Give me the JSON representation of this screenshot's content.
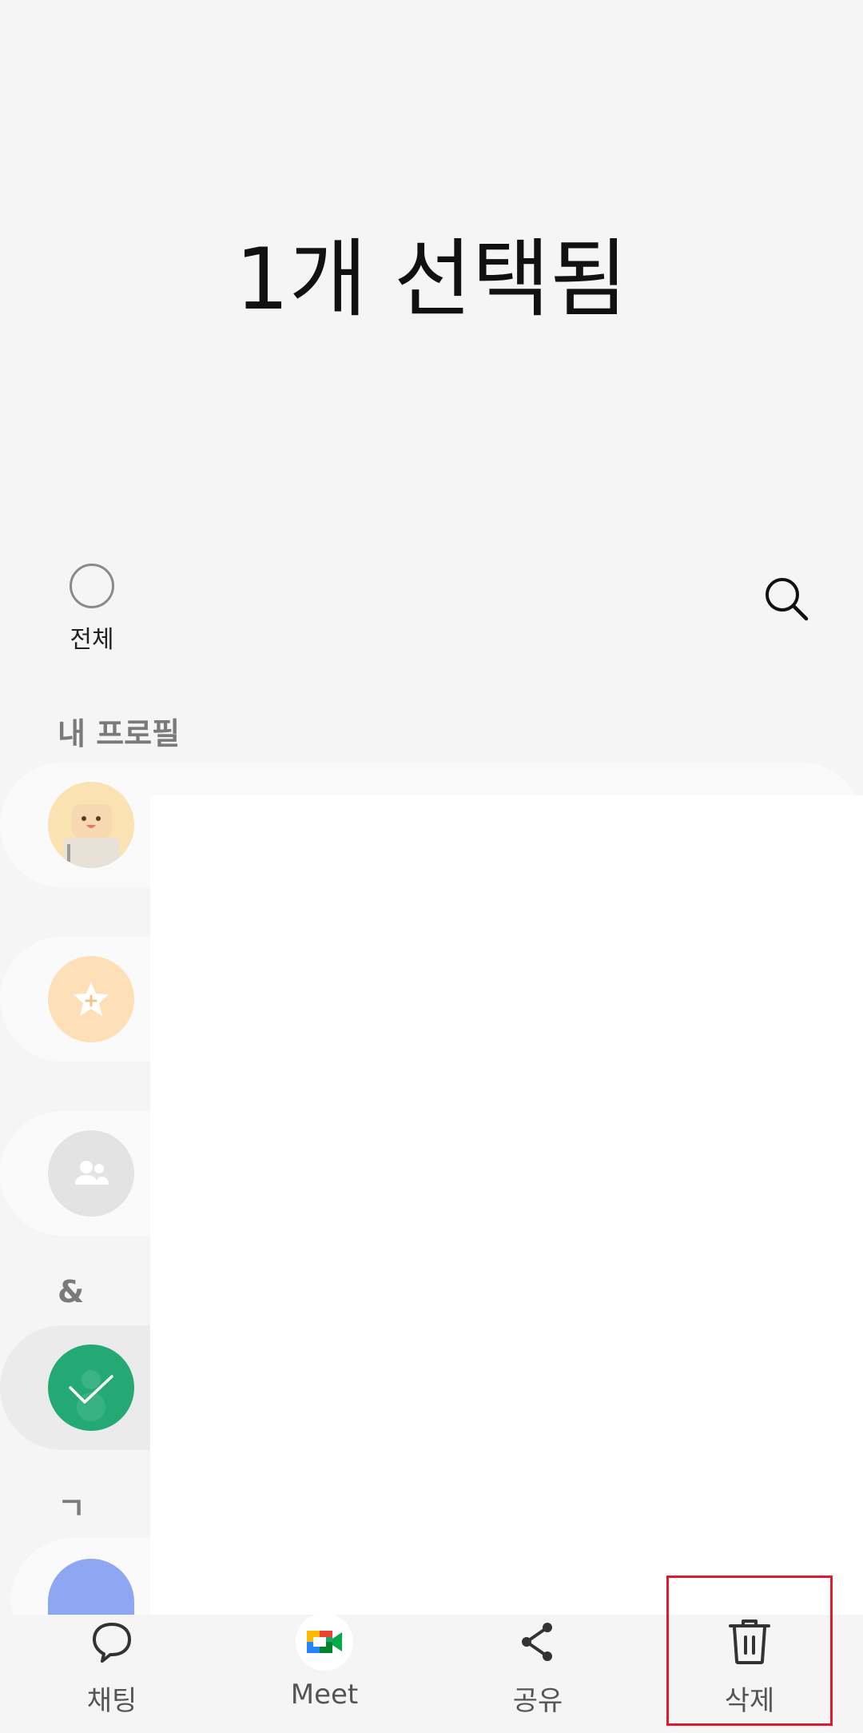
{
  "header": {
    "title": "1개 선택됨"
  },
  "toolbar": {
    "select_all_label": "전체"
  },
  "sections": {
    "my_profile": "내 프로필",
    "ampersand": "&",
    "giyeok": "ㄱ"
  },
  "bottom_nav": {
    "chat": "채팅",
    "meet": "Meet",
    "share": "공유",
    "delete": "삭제"
  },
  "colors": {
    "accent_selected": "#24a974",
    "highlight": "#e0192c"
  }
}
